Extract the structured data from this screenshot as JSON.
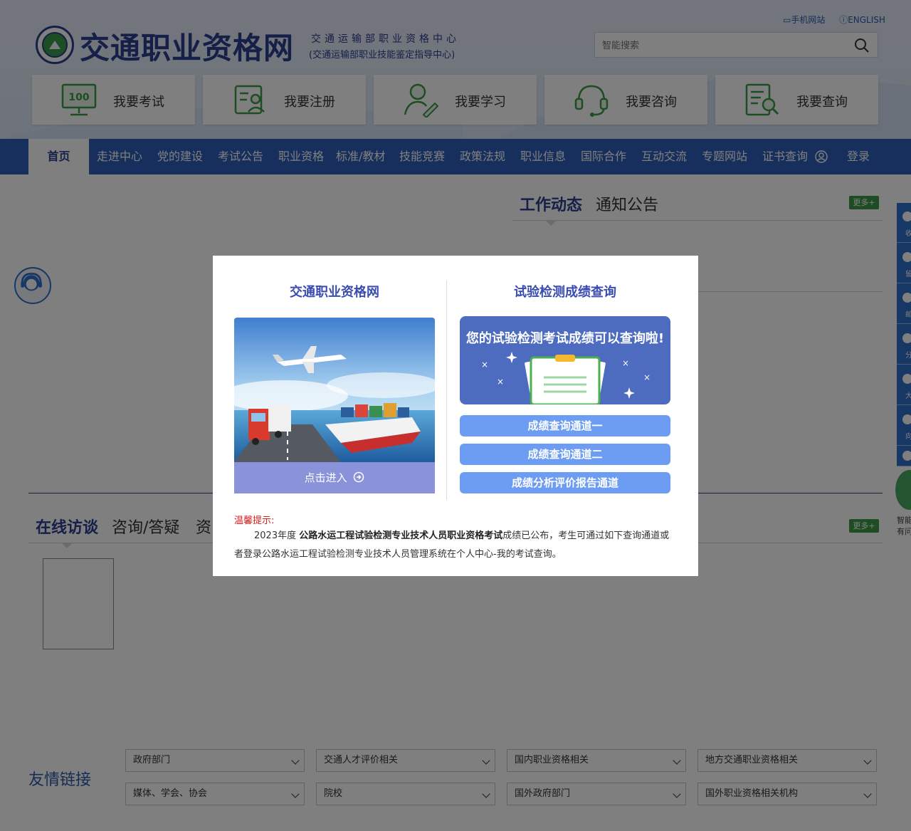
{
  "header": {
    "site_title": "交通职业资格网",
    "subtitle_1": "交通运输部职业资格中心",
    "subtitle_2": "(交通运输部职业技能鉴定指导中心)",
    "mobile_link": "手机网站",
    "english_link": "ENGLISH",
    "search_placeholder": "智能搜索"
  },
  "quick_links": [
    {
      "label": "我要考试",
      "icon": "exam-monitor-icon"
    },
    {
      "label": "我要注册",
      "icon": "register-profile-icon"
    },
    {
      "label": "我要学习",
      "icon": "study-user-pen-icon"
    },
    {
      "label": "我要咨询",
      "icon": "headset-icon"
    },
    {
      "label": "我要查询",
      "icon": "document-search-icon"
    }
  ],
  "nav": {
    "items": [
      "首页",
      "走进中心",
      "党的建设",
      "考试公告",
      "职业资格",
      "标准/教材",
      "技能竞赛",
      "政策法规",
      "职业信息",
      "国际合作",
      "互动交流",
      "专题网站",
      "证书查询",
      "登录"
    ],
    "active_index": 0
  },
  "news_tabs": {
    "tabs": [
      "工作动态",
      "通知公告"
    ],
    "more": "更多+"
  },
  "interview_tabs": {
    "tabs": [
      "在线访谈",
      "咨询/答疑",
      "资"
    ],
    "more": "更多+"
  },
  "friend_links": {
    "title": "友情链接",
    "selects": [
      "政府部门",
      "交通人才评价相关",
      "国内职业资格相关",
      "地方交通职业资格相关",
      "媒体、学会、协会",
      "院校",
      "国外政府部门",
      "国外职业资格相关机构"
    ]
  },
  "side_rail": {
    "items": [
      "收",
      "留",
      "邮",
      "分",
      "大",
      "向",
      "Q"
    ]
  },
  "bot": {
    "line_1": "智能",
    "line_2": "有问"
  },
  "modal": {
    "left_title": "交通职业资格网",
    "enter_label": "点击进入",
    "right_title": "试验检测成绩查询",
    "banner_text": "您的试验检测考试成绩可以查询啦!",
    "buttons": [
      "成绩查询通道一",
      "成绩查询通道二",
      "成绩分析评价报告通道"
    ],
    "notice_title": "温馨提示:",
    "notice_year": "2023年度",
    "notice_bold": "公路水运工程试验检测专业技术人员职业资格考试",
    "notice_rest": "成绩已公布，考生可通过如下查询通道或者登录公路水运工程试验检测专业技术人员管理系统在个人中心-我的考试查询。"
  },
  "colors": {
    "nav_bg": "#2f5fb8",
    "brand_dark": "#2b3f8e",
    "more_green": "#3f9a46",
    "query_button": "#6d9df2",
    "enter_bar": "#8a93d9",
    "notice_red": "#d41d1d"
  }
}
